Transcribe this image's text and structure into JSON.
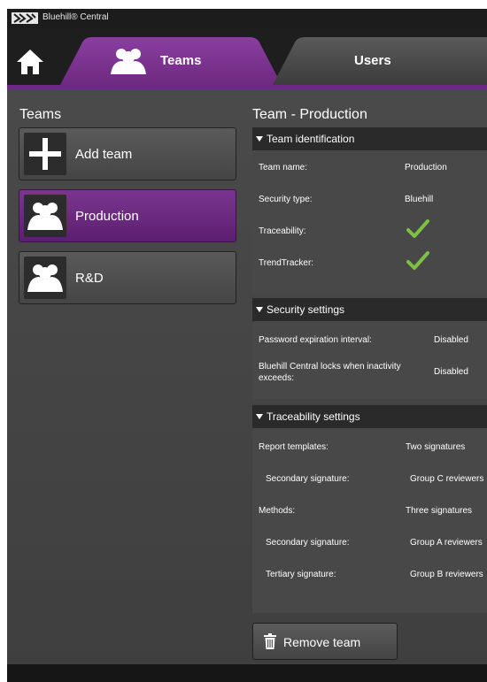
{
  "app": {
    "title": "Bluehill® Central"
  },
  "tabs": [
    {
      "label": "Teams",
      "active": true
    },
    {
      "label": "Users",
      "active": false
    }
  ],
  "left": {
    "title": "Teams",
    "add_label": "Add team",
    "teams": [
      {
        "name": "Production",
        "selected": true
      },
      {
        "name": "R&D",
        "selected": false
      }
    ]
  },
  "detail": {
    "title": "Team - Production",
    "identification": {
      "header": "Team identification",
      "team_name_label": "Team name:",
      "team_name_value": "Production",
      "security_type_label": "Security type:",
      "security_type_value": "Bluehill",
      "traceability_label": "Traceability:",
      "traceability_value": "checkmark-icon",
      "trendtracker_label": "TrendTracker:",
      "trendtracker_value": "checkmark-icon"
    },
    "security": {
      "header": "Security settings",
      "password_label": "Password expiration interval:",
      "password_value": "Disabled",
      "lock_label_line1": "Bluehill Central locks when inactivity",
      "lock_label_line2": "exceeds:",
      "lock_value": "Disabled"
    },
    "traceability": {
      "header": "Traceability settings",
      "report_templates_label": "Report templates:",
      "report_templates_value": "Two signatures",
      "rt_secondary_label": "Secondary signature:",
      "rt_secondary_value": "Group C reviewers",
      "methods_label": "Methods:",
      "methods_value": "Three signatures",
      "m_secondary_label": "Secondary signature:",
      "m_secondary_value": "Group A reviewers",
      "m_tertiary_label": "Tertiary signature:",
      "m_tertiary_value": "Group B reviewers"
    },
    "remove_label": "Remove team"
  },
  "colors": {
    "accent_purple": "#6e2a80",
    "check_green": "#7cc142"
  }
}
